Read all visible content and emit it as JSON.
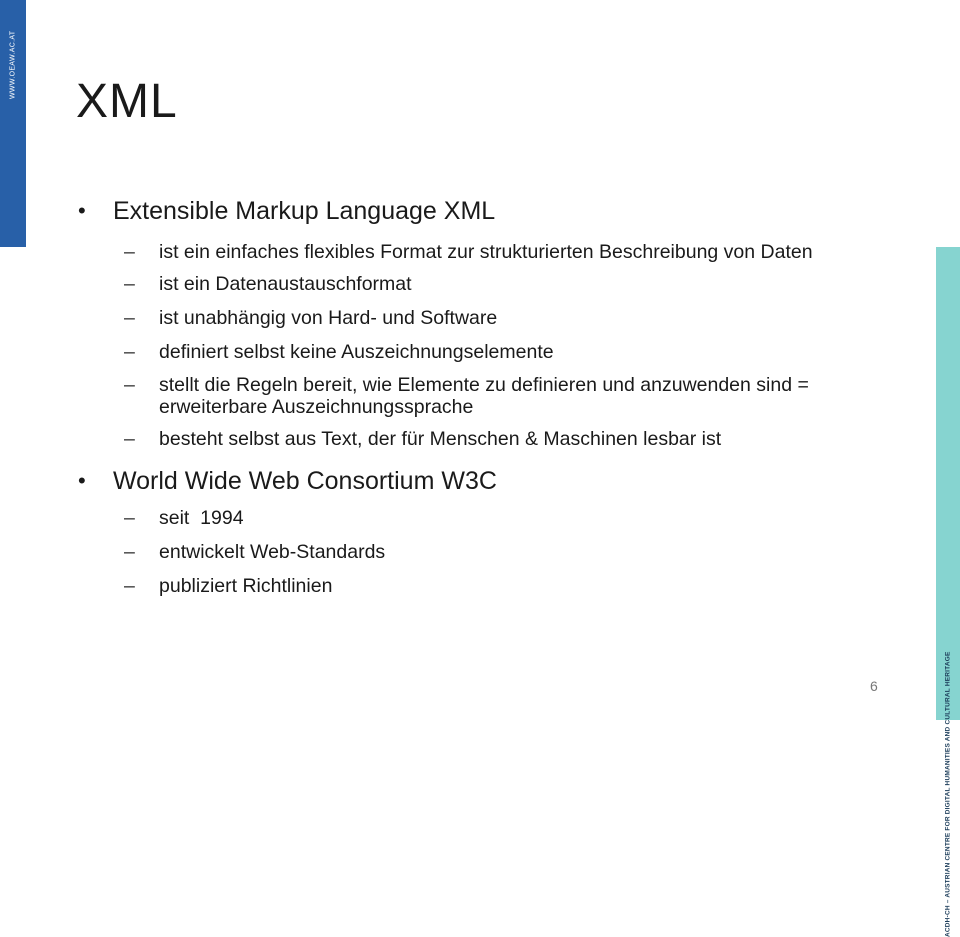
{
  "sidebar_left": {
    "text": "WWW.OEAW.AC.AT"
  },
  "sidebar_right": {
    "text": "ACDH-CH – AUSTRIAN CENTRE FOR DIGITAL HUMANITIES AND CULTURAL HERITAGE"
  },
  "slide": {
    "title": "XML",
    "bullets": [
      {
        "text": "Extensible Markup Language XML",
        "subs": [
          "ist ein einfaches flexibles Format zur strukturierten Beschreibung von Daten",
          "ist ein Datenaustauschformat",
          "ist unabhängig von Hard- und Software",
          "definiert selbst keine Auszeichnungselemente",
          "stellt die Regeln bereit, wie Elemente zu definieren und anzuwenden sind = erweiterbare Auszeichnungssprache",
          "besteht selbst aus Text, der für Menschen & Maschinen lesbar ist"
        ]
      },
      {
        "text": "World Wide Web Consortium W3C",
        "subs": [
          "seit  1994",
          "entwickelt Web-Standards",
          "publiziert Richtlinien"
        ]
      }
    ],
    "bullet_symbol": "•",
    "dash_symbol": "–",
    "page_number": "6"
  },
  "colors": {
    "left_bar": "#2860a8",
    "right_bar": "#86d4d0"
  }
}
